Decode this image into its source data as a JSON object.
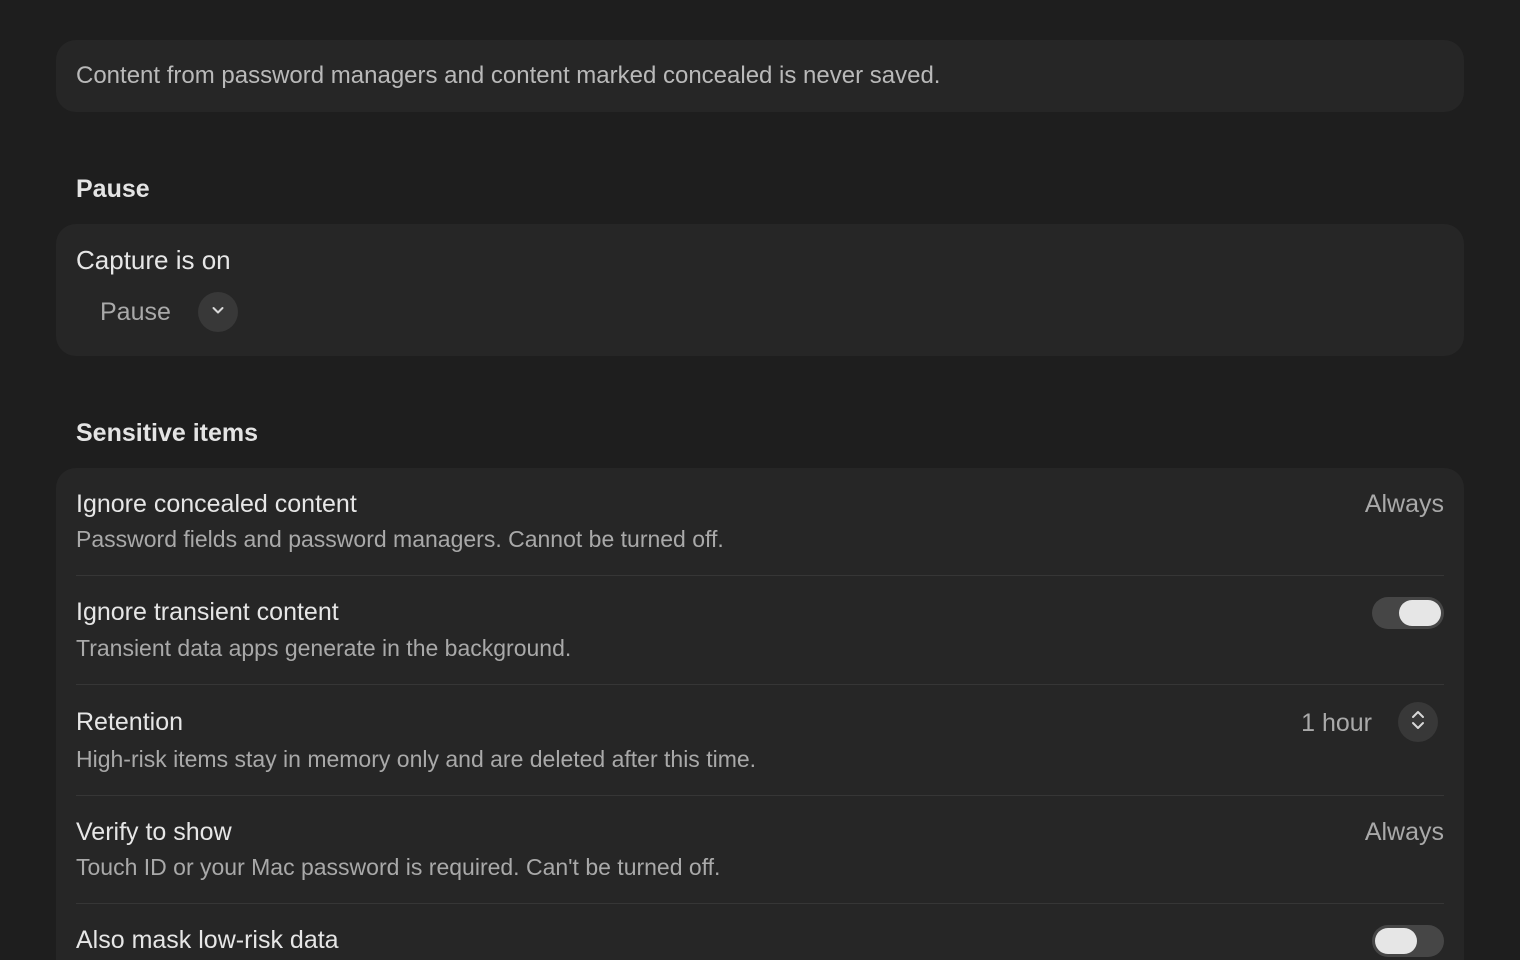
{
  "notice": {
    "text": "Content from password managers and content marked concealed is never saved."
  },
  "pause_section": {
    "title": "Pause",
    "status_label": "Capture is on",
    "dropdown_label": "Pause",
    "dropdown_icon": "chevron-down-icon"
  },
  "sensitive_section": {
    "title": "Sensitive items",
    "rows": [
      {
        "title": "Ignore concealed content",
        "description": "Password fields and password managers. Cannot be turned off.",
        "value": "Always"
      },
      {
        "title": "Ignore transient content",
        "description": "Transient data apps generate in the background.",
        "toggle_on": true
      },
      {
        "title": "Retention",
        "description": "High-risk items stay in memory only and are deleted after this time.",
        "value": "1 hour",
        "stepper_icon": "up-down-chevron-icon"
      },
      {
        "title": "Verify to show",
        "description": "Touch ID or your Mac password is required. Can't be turned off.",
        "value": "Always"
      },
      {
        "title": "Also mask low-risk data",
        "toggle_on": false
      }
    ]
  },
  "colors": {
    "background": "#1e1e1e",
    "card": "#262626",
    "primary_text": "#e6e6e6",
    "secondary_text": "#a9a9a9",
    "toggle_track": "#464646",
    "toggle_knob": "#e6e6e6"
  }
}
